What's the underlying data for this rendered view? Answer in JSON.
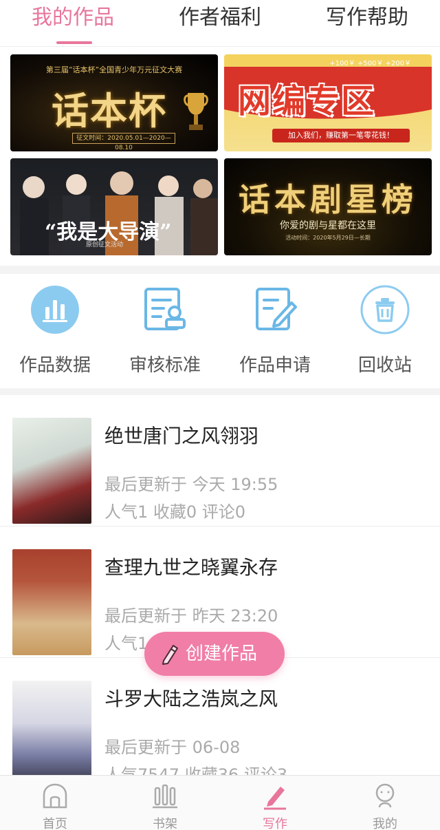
{
  "top_tabs": {
    "items": [
      {
        "label": "我的作品",
        "active": true
      },
      {
        "label": "作者福利",
        "active": false
      },
      {
        "label": "写作帮助",
        "active": false
      }
    ]
  },
  "banners": {
    "b1": {
      "subtitle": "第三届“话本杯”全国青少年万元征文大赛",
      "title": "话本杯",
      "date": "征文时间：2020.05.01—2020—08.10"
    },
    "b2": {
      "title": "网编专区",
      "coins": "+100￥ +500￥ +200￥",
      "strip": "加入我们，赚取第一笔零花钱！"
    },
    "b3": {
      "title": "“我是大导演”",
      "sub": "原创征文活动"
    },
    "b4": {
      "title": "话本剧星榜",
      "sub": "你爱的剧与星都在这里",
      "date": "活动时间：2020年5月29日—长期"
    }
  },
  "tools": [
    {
      "label": "作品数据",
      "icon": "bar-chart-icon"
    },
    {
      "label": "审核标准",
      "icon": "review-icon"
    },
    {
      "label": "作品申请",
      "icon": "edit-document-icon"
    },
    {
      "label": "回收站",
      "icon": "trash-icon"
    }
  ],
  "works": [
    {
      "title": "绝世唐门之风翎羽",
      "updated": "最后更新于 今天 19:55",
      "stats": "人气1 收藏0 评论0"
    },
    {
      "title": "查理九世之晓翼永存",
      "updated": "最后更新于 昨天 23:20",
      "stats": "人气1  收藏0 评论3"
    },
    {
      "title": "斗罗大陆之浩岚之风",
      "updated": "最后更新于 06-08",
      "stats": "人气7547 收藏36 评论3"
    }
  ],
  "create_button": {
    "label": "创建作品"
  },
  "bottom_nav": [
    {
      "label": "首页",
      "active": false
    },
    {
      "label": "书架",
      "active": false
    },
    {
      "label": "写作",
      "active": true
    },
    {
      "label": "我的",
      "active": false
    }
  ],
  "colors": {
    "accent": "#e8769a",
    "icon_blue": "#6ab7e6"
  }
}
